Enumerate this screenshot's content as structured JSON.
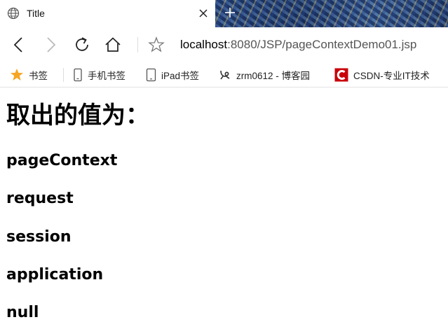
{
  "tab": {
    "title": "Title"
  },
  "address_bar": {
    "host": "localhost",
    "path": ":8080/JSP/pageContextDemo01.jsp"
  },
  "bookmarks": [
    {
      "label": "书签",
      "icon": "star-icon"
    },
    {
      "label": "手机书签",
      "icon": "phone-icon"
    },
    {
      "label": "iPad书签",
      "icon": "tablet-icon"
    },
    {
      "label": "zrm0612 - 博客园",
      "icon": "cnblogs-icon"
    },
    {
      "label": "CSDN-专业IT技术",
      "icon": "csdn-icon"
    }
  ],
  "page": {
    "heading": "取出的值为：",
    "values": [
      "pageContext",
      "request",
      "session",
      "application",
      "null"
    ]
  },
  "colors": {
    "star": "#f5a623",
    "csdn": "#c9000a"
  }
}
